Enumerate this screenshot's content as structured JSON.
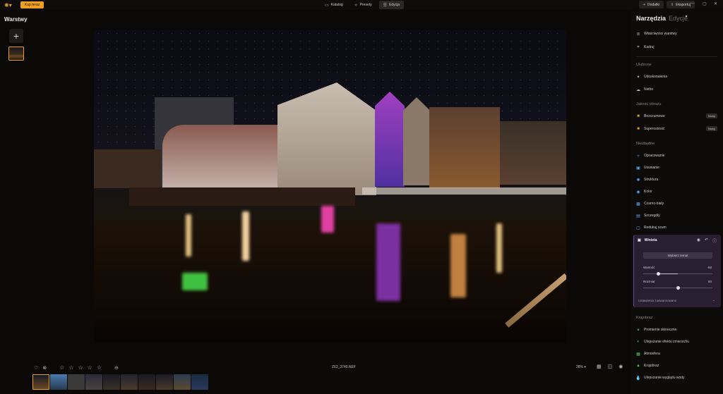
{
  "topbar": {
    "buy_label": "Kup teraz",
    "tabs": [
      {
        "label": "Katalog",
        "icon": "folder-icon"
      },
      {
        "label": "Presety",
        "icon": "presets-icon"
      },
      {
        "label": "Edycja",
        "icon": "sliders-icon",
        "active": true
      }
    ],
    "add_label": "Dodatki",
    "export_label": "Eksportuj"
  },
  "layers": {
    "title": "Warstwy"
  },
  "bottombar": {
    "filename": "Z62_3740.NEF",
    "zoom": "28%",
    "rating_stars": 5
  },
  "panel": {
    "tab_tools": "Narzędzia",
    "tab_edits": "Edycje",
    "items_top": [
      {
        "label": "Właściwości warstwy",
        "icon": "layers-icon"
      },
      {
        "label": "Kadruj",
        "icon": "crop-icon"
      }
    ],
    "sec_favorites": "Ulubione",
    "favorites": [
      {
        "label": "Udoskonalenia",
        "icon": "sparkle-icon"
      },
      {
        "label": "Niebo",
        "icon": "cloud-icon"
      }
    ],
    "sec_quality": "Jakość obrazu",
    "quality": [
      {
        "label": "Bezszumowe",
        "icon": "denoise-icon",
        "badge": "Nowy"
      },
      {
        "label": "Superostrość",
        "icon": "sharpen-icon",
        "badge": "Nowy"
      }
    ],
    "sec_essentials": "Niezbędne",
    "essentials": [
      {
        "label": "Opracowanie",
        "icon": "develop-icon"
      },
      {
        "label": "Usuwanie",
        "icon": "eraser-icon"
      },
      {
        "label": "Struktura",
        "icon": "structure-icon"
      },
      {
        "label": "Kolor",
        "icon": "color-icon"
      },
      {
        "label": "Czarno-biały",
        "icon": "bw-icon"
      },
      {
        "label": "Szczegóły",
        "icon": "details-icon"
      },
      {
        "label": "Redukuj szum",
        "icon": "noise-icon"
      }
    ],
    "vignette": {
      "title": "Winieta",
      "select_center": "Wybierz temat",
      "amount_label": "Wartość",
      "amount_value": "-58",
      "size_label": "Rozmiar",
      "size_value": "50",
      "advanced": "Ustawienia zaawansowane"
    },
    "sec_landscape": "Krajobraz",
    "landscape": [
      {
        "label": "Promienie słoneczne",
        "icon": "sunrays-icon"
      },
      {
        "label": "Ulepszanie efektu zmierzchu",
        "icon": "dusk-icon"
      },
      {
        "label": "Atmosfera",
        "icon": "atmosphere-icon"
      },
      {
        "label": "Krajobraz",
        "icon": "landscape-icon"
      },
      {
        "label": "Ulepszanie wyglądu wody",
        "icon": "water-icon"
      }
    ],
    "accent": "#e6a020",
    "vignette_bg": "#2a1e32"
  }
}
